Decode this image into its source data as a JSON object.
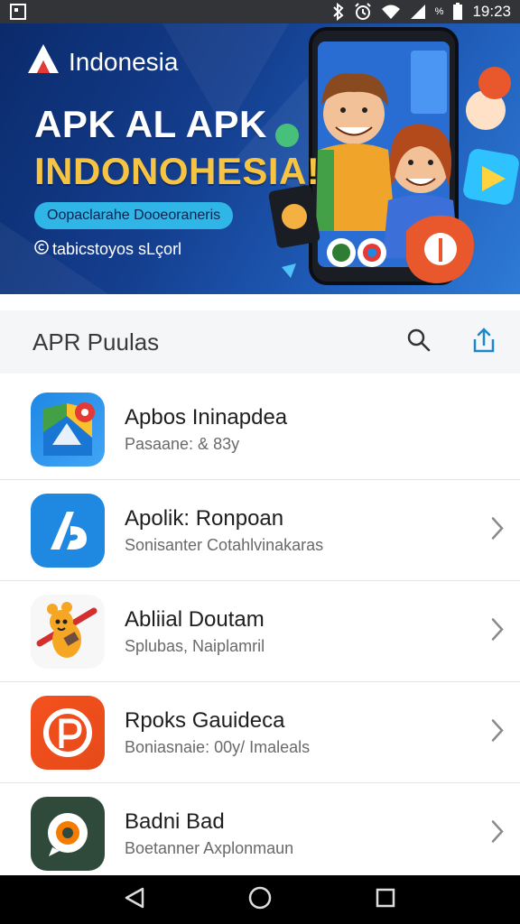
{
  "status_bar": {
    "time": "19:23",
    "battery_label": "%",
    "icons": [
      "screenshot-icon",
      "bluetooth-icon",
      "alarm-icon",
      "wifi-icon",
      "signal-icon",
      "battery-icon"
    ]
  },
  "banner": {
    "brand": "Indonesia",
    "headline_line1": "APK AL APK",
    "headline_line2": "INDONOHESIA!",
    "pill_text": "Oopaclarahe Dooeoraneris",
    "url_text": "tabicstoyos sLçorl",
    "colors": {
      "background": "#143e8e",
      "headline_accent": "#f6c343",
      "pill": "#2fb5e6"
    }
  },
  "header": {
    "title": "APR Puulas",
    "actions": [
      "search-icon",
      "share-icon"
    ]
  },
  "apps": [
    {
      "title": "Apbos Ininapdea",
      "subtitle": "Pasaane: & 83y",
      "icon": "maps-app-icon",
      "has_chevron": false
    },
    {
      "title": "Apolik: Ronpoan",
      "subtitle": "Sonisanter Cotahlvinakaras",
      "icon": "a-letter-app-icon",
      "has_chevron": true
    },
    {
      "title": "Abliial Doutam",
      "subtitle": "Splubas, Naiplamril",
      "icon": "mascot-app-icon",
      "has_chevron": true
    },
    {
      "title": "Rpoks Gauideca",
      "subtitle": "Boniasnaie: 00y/ Imaleals",
      "icon": "p-letter-app-icon",
      "has_chevron": true
    },
    {
      "title": "Badni Bad",
      "subtitle": "Boetanner Axplonmaun",
      "icon": "chat-app-icon",
      "has_chevron": true
    }
  ],
  "nav_bar": {
    "buttons": [
      "back-icon",
      "home-icon",
      "recents-icon"
    ]
  }
}
